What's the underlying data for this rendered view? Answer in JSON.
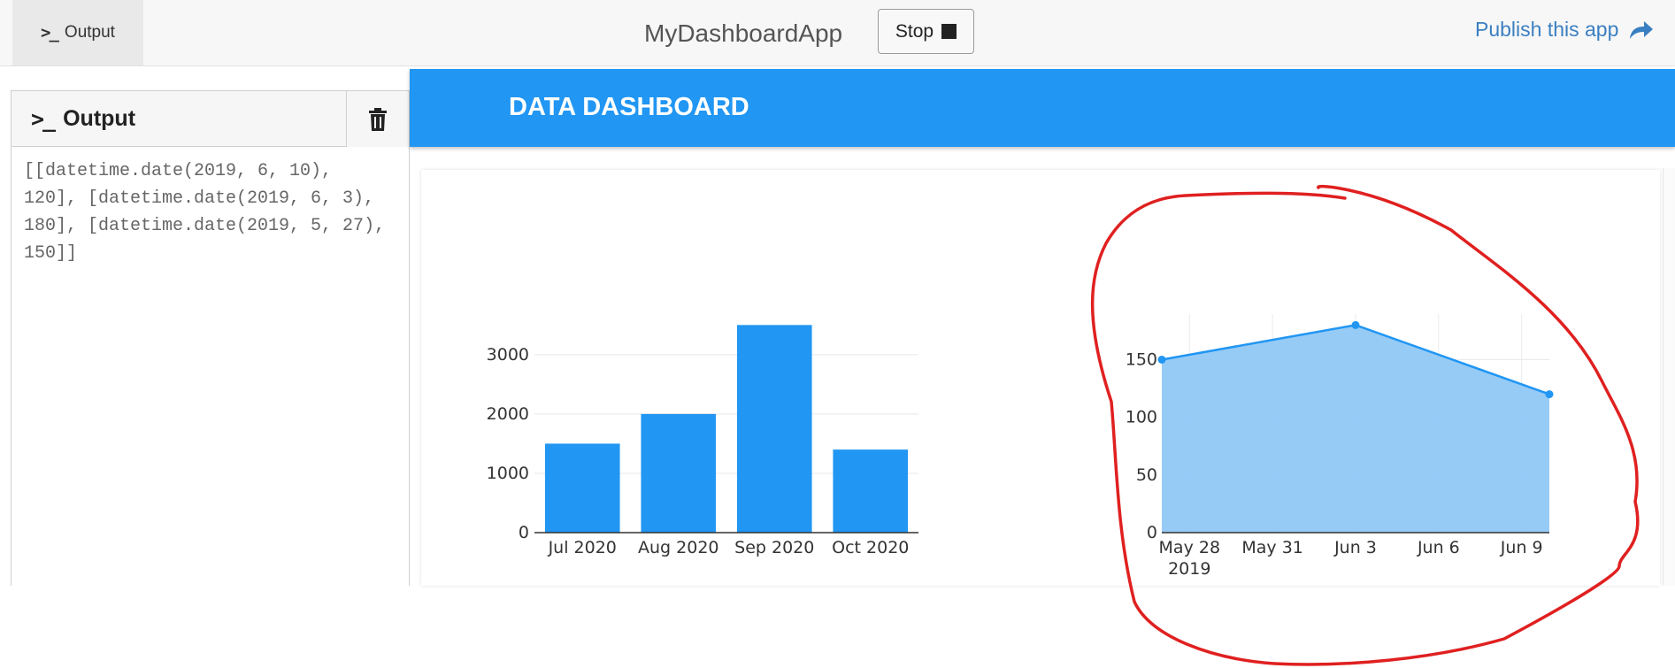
{
  "topbar": {
    "output_tab_label": "Output",
    "app_title": "MyDashboardApp",
    "stop_label": "Stop",
    "publish_label": "Publish this app"
  },
  "output_panel": {
    "title": "Output",
    "text": "[[datetime.date(2019, 6, 10), 120], [datetime.date(2019, 6, 3), 180], [datetime.date(2019, 5, 27), 150]]"
  },
  "dashboard": {
    "title": "DATA DASHBOARD"
  },
  "colors": {
    "accent": "#2196f3",
    "area_fill": "#90c8f6",
    "annotation": "#e02020"
  },
  "chart_data": [
    {
      "type": "bar",
      "categories": [
        "Jul 2020",
        "Aug 2020",
        "Sep 2020",
        "Oct 2020"
      ],
      "values": [
        1500,
        2000,
        3500,
        1400
      ],
      "yticks": [
        0,
        1000,
        2000,
        3000
      ],
      "ylim": [
        0,
        3684
      ],
      "grid": true
    },
    {
      "type": "area",
      "x": [
        "2019-05-27",
        "2019-06-03",
        "2019-06-10"
      ],
      "values": [
        150,
        180,
        120
      ],
      "xticks": [
        "May 28",
        "May 31",
        "Jun 3",
        "Jun 6",
        "Jun 9"
      ],
      "xtick_year": "2019",
      "yticks": [
        0,
        50,
        100,
        150
      ],
      "ylim": [
        0,
        189.5
      ],
      "grid": true
    }
  ]
}
